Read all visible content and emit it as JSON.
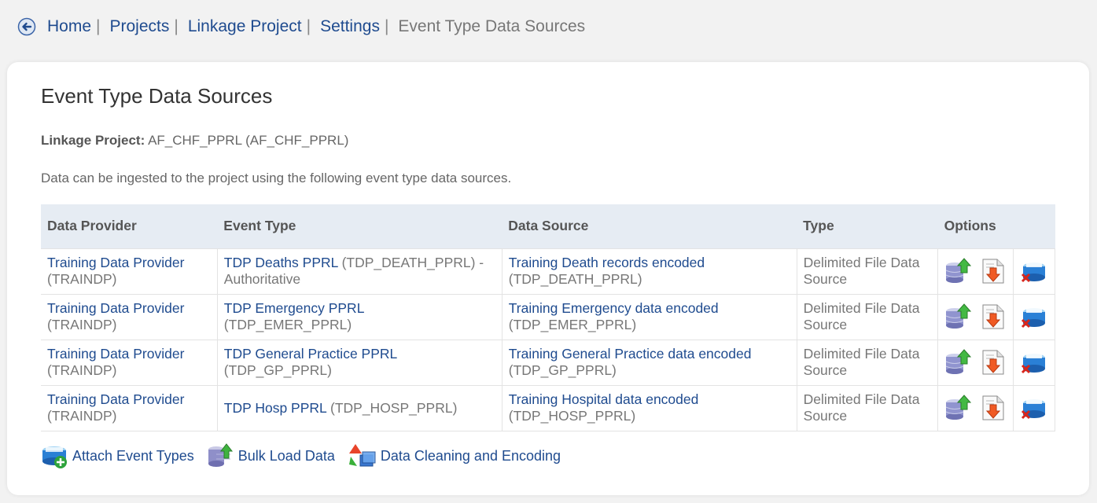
{
  "breadcrumb": {
    "items": [
      "Home",
      "Projects",
      "Linkage Project",
      "Settings"
    ],
    "current": "Event Type Data Sources",
    "separator": "|"
  },
  "page": {
    "title": "Event Type Data Sources",
    "project_label": "Linkage Project:",
    "project_value": "AF_CHF_PPRL (AF_CHF_PPRL)",
    "intro": "Data can be ingested to the project using the following event type data sources."
  },
  "table": {
    "headers": [
      "Data Provider",
      "Event Type",
      "Data Source",
      "Type",
      "Options"
    ],
    "rows": [
      {
        "provider": "Training Data Provider",
        "provider_code": "(TRAINDP)",
        "event_type": "TDP Deaths PPRL",
        "event_code": "(TDP_DEATH_PPRL) -",
        "event_note": "Authoritative",
        "source": "Training Death records encoded",
        "source_code": "(TDP_DEATH_PPRL)",
        "type_line1": "Delimited File Data",
        "type_line2": "Source"
      },
      {
        "provider": "Training Data Provider",
        "provider_code": "(TRAINDP)",
        "event_type": "TDP Emergency PPRL",
        "event_code": "(TDP_EMER_PPRL)",
        "event_note": "",
        "source": "Training Emergency data encoded",
        "source_code": "(TDP_EMER_PPRL)",
        "type_line1": "Delimited File Data",
        "type_line2": "Source"
      },
      {
        "provider": "Training Data Provider",
        "provider_code": "(TRAINDP)",
        "event_type": "TDP General Practice PPRL",
        "event_code": "(TDP_GP_PPRL)",
        "event_note": "",
        "source": "Training General Practice data encoded",
        "source_code": "(TDP_GP_PPRL)",
        "type_line1": "Delimited File Data",
        "type_line2": "Source"
      },
      {
        "provider": "Training Data Provider",
        "provider_code": "(TRAINDP)",
        "event_type": "TDP Hosp PPRL",
        "event_code": "(TDP_HOSP_PPRL)",
        "event_note": "",
        "source": "Training Hospital data encoded",
        "source_code": "(TDP_HOSP_PPRL)",
        "type_line1": "Delimited File Data",
        "type_line2": "Source"
      }
    ],
    "option_icons": [
      "database-upload-icon",
      "document-download-icon",
      "database-remove-icon"
    ]
  },
  "actions": {
    "attach": "Attach Event Types",
    "bulk_load": "Bulk Load Data",
    "cleaning": "Data Cleaning and Encoding"
  },
  "colors": {
    "link": "#1f4b8f",
    "header_bg": "#e6ecf3",
    "page_bg": "#f2f2f2"
  }
}
